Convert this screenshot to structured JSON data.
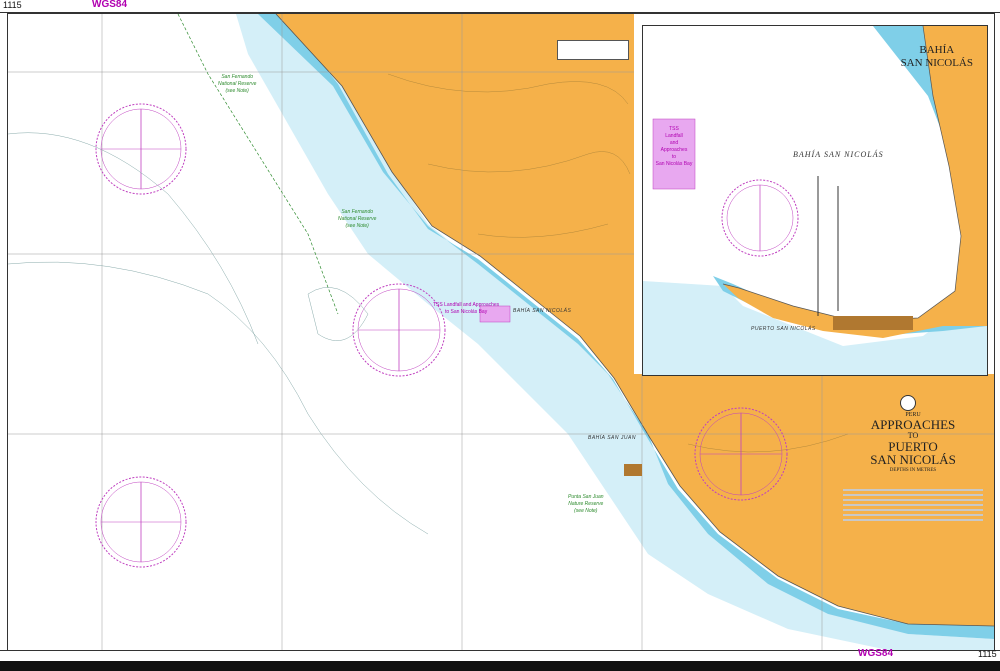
{
  "chart_number": "1115",
  "datum": "WGS84",
  "main_title": {
    "country": "PERU",
    "line1": "APPROACHES",
    "line2": "TO",
    "line3": "PUERTO",
    "line4": "SAN NICOLÁS",
    "subtitle": "DEPTHS IN METRES"
  },
  "inset": {
    "title_line1": "BAHÍA",
    "title_line2": "SAN NICOLÁS",
    "bay_label": "BAHÍA SAN NICOLÁS",
    "port_label": "PUERTO SAN NICOLÁS",
    "tss_note": [
      "TSS",
      "Landfall",
      "and",
      "Approaches",
      "to",
      "San Nicolás Bay"
    ]
  },
  "labels": {
    "reserve_north": [
      "San Fernando",
      "National Reserve",
      "(see Note)"
    ],
    "reserve_mid": [
      "San Fernando",
      "National Reserve",
      "(see Note)"
    ],
    "reserve_south": [
      "Punta San Juan",
      "Nature Reserve",
      "(see Note)"
    ],
    "tss_main": [
      "TSS Landfall and Approaches",
      "to San Nicolás Bay"
    ],
    "bahia_san_juan": "BAHÍA SAN JUAN",
    "bahia_san_nicolas": "BAHÍA SAN NICOLÁS"
  },
  "colors": {
    "land": "#f5b14a",
    "shallow_water": "#7fcfe8",
    "mid_water": "#bfe8f4",
    "deep_water": "#ffffff",
    "magenta": "#c040c0",
    "reserve_green": "#2e8b2e"
  }
}
